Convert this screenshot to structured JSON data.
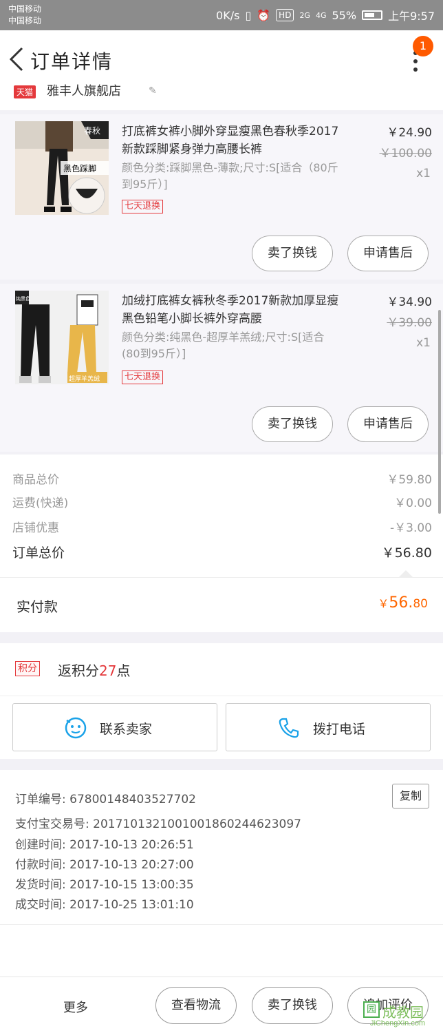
{
  "status_bar": {
    "carrier1": "中国移动",
    "carrier2": "中国移动",
    "speed": "0K/s",
    "hd": "HD",
    "net2g": "2G",
    "net4g": "4G",
    "battery": "55%",
    "time": "上午9:57"
  },
  "nav": {
    "title": "订单详情",
    "badge": "1"
  },
  "shop": {
    "platform": "天猫",
    "name": "雅丰人旗舰店"
  },
  "items": [
    {
      "title": "打底裤女裤小脚外穿显瘦黑色春秋季2017新款踩脚紧身弹力高腰长裤",
      "sku": "颜色分类:踩脚黑色-薄款;尺寸:S[适合（80斤到95斤）]",
      "tag": "七天退换",
      "price": "￥24.90",
      "original_price": "￥100.00",
      "qty": "x1",
      "thumb_label_top": "春秋",
      "thumb_label_bottom": "黑色踩脚",
      "btn_sell": "卖了换钱",
      "btn_after": "申请售后"
    },
    {
      "title": "加绒打底裤女裤秋冬季2017新款加厚显瘦黑色铅笔小脚长裤外穿高腰",
      "sku": "颜色分类:纯黑色-超厚羊羔绒;尺寸:S[适合(80到95斤）]",
      "tag": "七天退换",
      "price": "￥34.90",
      "original_price": "￥39.00",
      "qty": "x1",
      "thumb_label_top": "纯黑色",
      "thumb_label_bottom": "超厚羊羔绒",
      "btn_sell": "卖了换钱",
      "btn_after": "申请售后"
    }
  ],
  "summary": {
    "goods_label": "商品总价",
    "goods_value": "￥59.80",
    "shipping_label": "运费(快递)",
    "shipping_value": "￥0.00",
    "discount_label": "店铺优惠",
    "discount_value": "-￥3.00",
    "total_label": "订单总价",
    "total_value": "￥56.80"
  },
  "paid": {
    "label": "实付款",
    "symbol": "￥",
    "integer": "56.",
    "decimal": "80"
  },
  "points": {
    "tag": "积分",
    "prefix": "返积分",
    "number": "27",
    "suffix": "点"
  },
  "contact": {
    "seller": "联系卖家",
    "phone": "拨打电话"
  },
  "order_info": {
    "order_no": "订单编号: 67800148403527702",
    "alipay_no": "支付宝交易号: 2017101321001001860244623097",
    "created": "创建时间: 2017-10-13 20:26:51",
    "paid_time": "付款时间: 2017-10-13 20:27:00",
    "shipped": "发货时间: 2017-10-15 13:00:35",
    "completed": "成交时间: 2017-10-25 13:01:10",
    "copy": "复制"
  },
  "bottom": {
    "more": "更多",
    "logistics": "查看物流",
    "sell": "卖了换钱",
    "review": "追加评价"
  },
  "watermark": {
    "box": "园",
    "text": "成教园",
    "url": "JiChengXin.com"
  }
}
